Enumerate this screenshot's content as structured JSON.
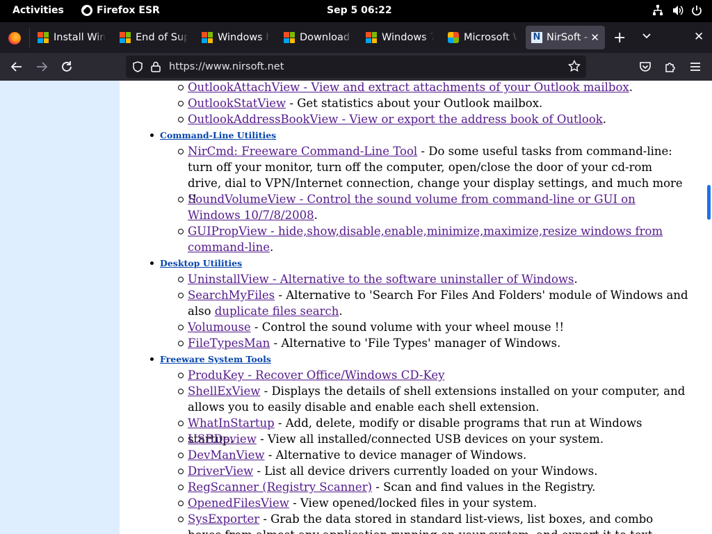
{
  "topbar": {
    "activities": "Activities",
    "app_name": "Firefox ESR",
    "clock": "Sep 5  06:22"
  },
  "tabs": [
    {
      "label": "Install Windows"
    },
    {
      "label": "End of Support"
    },
    {
      "label": "Windows help"
    },
    {
      "label": "Download Windows"
    },
    {
      "label": "Windows 7"
    },
    {
      "label": "Microsoft Windows"
    },
    {
      "label": "NirSoft - "
    }
  ],
  "navbar": {
    "url": "https://www.nirsoft.net"
  },
  "content": {
    "top_items": [
      {
        "link": "OutlookAttachView - View and extract attachments of your Outlook mailbox",
        "desc": "."
      },
      {
        "link": "OutlookStatView",
        "desc": " - Get statistics about your Outlook mailbox."
      },
      {
        "link": "OutlookAddressBookView - View or export the address book of Outlook",
        "desc": "."
      }
    ],
    "sections": [
      {
        "title": "Command-Line Utilities",
        "items": [
          {
            "link": "NirCmd: Freeware Command-Line Tool",
            "desc": " - Do some useful tasks from command-line: turn off your monitor, turn off the computer, open/close the door of your cd-rom drive, dial to VPN/Internet connection, change your display settings, and much more !!"
          },
          {
            "link": "SoundVolumeView - Control the sound volume from command-line or GUI on Windows 10/7/8/2008",
            "desc": "."
          },
          {
            "link": "GUIPropView - hide,show,disable,enable,minimize,maximize,resize windows from command-line",
            "desc": "."
          }
        ]
      },
      {
        "title": "Desktop Utilities",
        "items": [
          {
            "link": "UninstallView - Alternative to the software uninstaller of Windows",
            "desc": "."
          },
          {
            "link": "SearchMyFiles",
            "desc": " - Alternative to 'Search For Files And Folders' module of Windows and also ",
            "link2": "duplicate files search",
            "desc2": "."
          },
          {
            "link": "Volumouse",
            "desc": " - Control the sound volume with your wheel mouse !!"
          },
          {
            "link": "FileTypesMan",
            "desc": " - Alternative to 'File Types' manager of Windows."
          }
        ]
      },
      {
        "title": "Freeware System Tools",
        "items": [
          {
            "link": "ProduKey - Recover Office/Windows CD-Key",
            "desc": ""
          },
          {
            "link": "ShellExView",
            "desc": " - Displays the details of shell extensions installed on your computer, and allows you to easily disable and enable each shell extension."
          },
          {
            "link": "WhatInStartup",
            "desc": " - Add, delete, modify or disable programs that run at Windows startup."
          },
          {
            "link": "USBDeview",
            "desc": " - View all installed/connected USB devices on your system."
          },
          {
            "link": "DevManView",
            "desc": " - Alternative to device manager of Windows."
          },
          {
            "link": "DriverView",
            "desc": " - List all device drivers currently loaded on your Windows."
          },
          {
            "link": "RegScanner (Registry Scanner)",
            "desc": " - Scan and find values in the Registry."
          },
          {
            "link": "OpenedFilesView",
            "desc": " - View opened/locked files in your system."
          },
          {
            "link": "SysExporter",
            "desc": " - Grab the data stored in standard list-views, list boxes, and combo boxes from almost any application running on your system, and export it to text, HTML or XML file."
          }
        ]
      }
    ]
  }
}
